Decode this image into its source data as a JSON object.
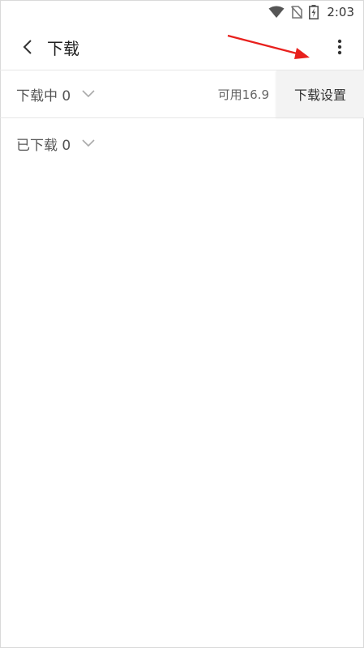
{
  "status_bar": {
    "time": "2:03",
    "icons": [
      "wifi-icon",
      "no-sim-icon",
      "battery-charging-icon"
    ]
  },
  "header": {
    "title": "下载",
    "back_icon": "back-chevron-icon",
    "more_icon": "more-vertical-icon"
  },
  "annotation": {
    "color": "#e8201d",
    "icon": "red-arrow"
  },
  "downloading": {
    "label": "下载中 0",
    "available": "可用16.9",
    "settings_label": "下载设置"
  },
  "downloaded": {
    "label": "已下载 0"
  }
}
